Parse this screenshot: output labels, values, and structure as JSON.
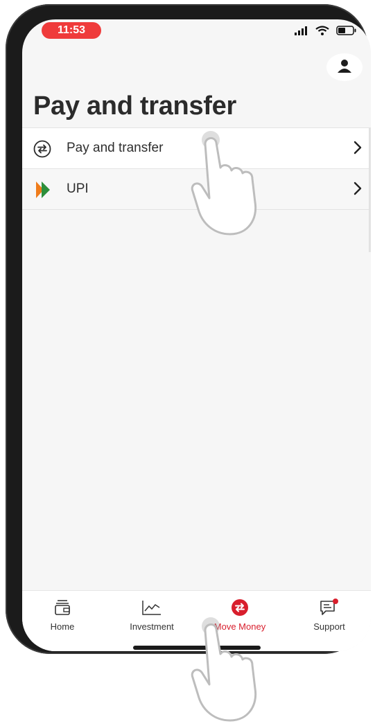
{
  "status_bar": {
    "time": "11:53",
    "icons": [
      "signal-icon",
      "wifi-icon",
      "battery-icon"
    ]
  },
  "header": {
    "profile_icon": "person-icon",
    "title": "Pay and transfer"
  },
  "menu": {
    "items": [
      {
        "label": "Pay and transfer",
        "icon": "transfer-arrows-icon"
      },
      {
        "label": "UPI",
        "icon": "upi-logo-icon"
      }
    ]
  },
  "bottom_nav": {
    "items": [
      {
        "label": "Home",
        "icon": "wallet-icon",
        "active": false
      },
      {
        "label": "Investment",
        "icon": "chart-icon",
        "active": false
      },
      {
        "label": "Move Money",
        "icon": "transfer-arrows-icon",
        "active": true
      },
      {
        "label": "Support",
        "icon": "chat-icon",
        "active": false
      }
    ]
  },
  "colors": {
    "accent": "#d81e2c",
    "time_pill": "#ef3b3b",
    "upi_orange": "#f07c1b",
    "upi_green": "#2d8f3c"
  }
}
